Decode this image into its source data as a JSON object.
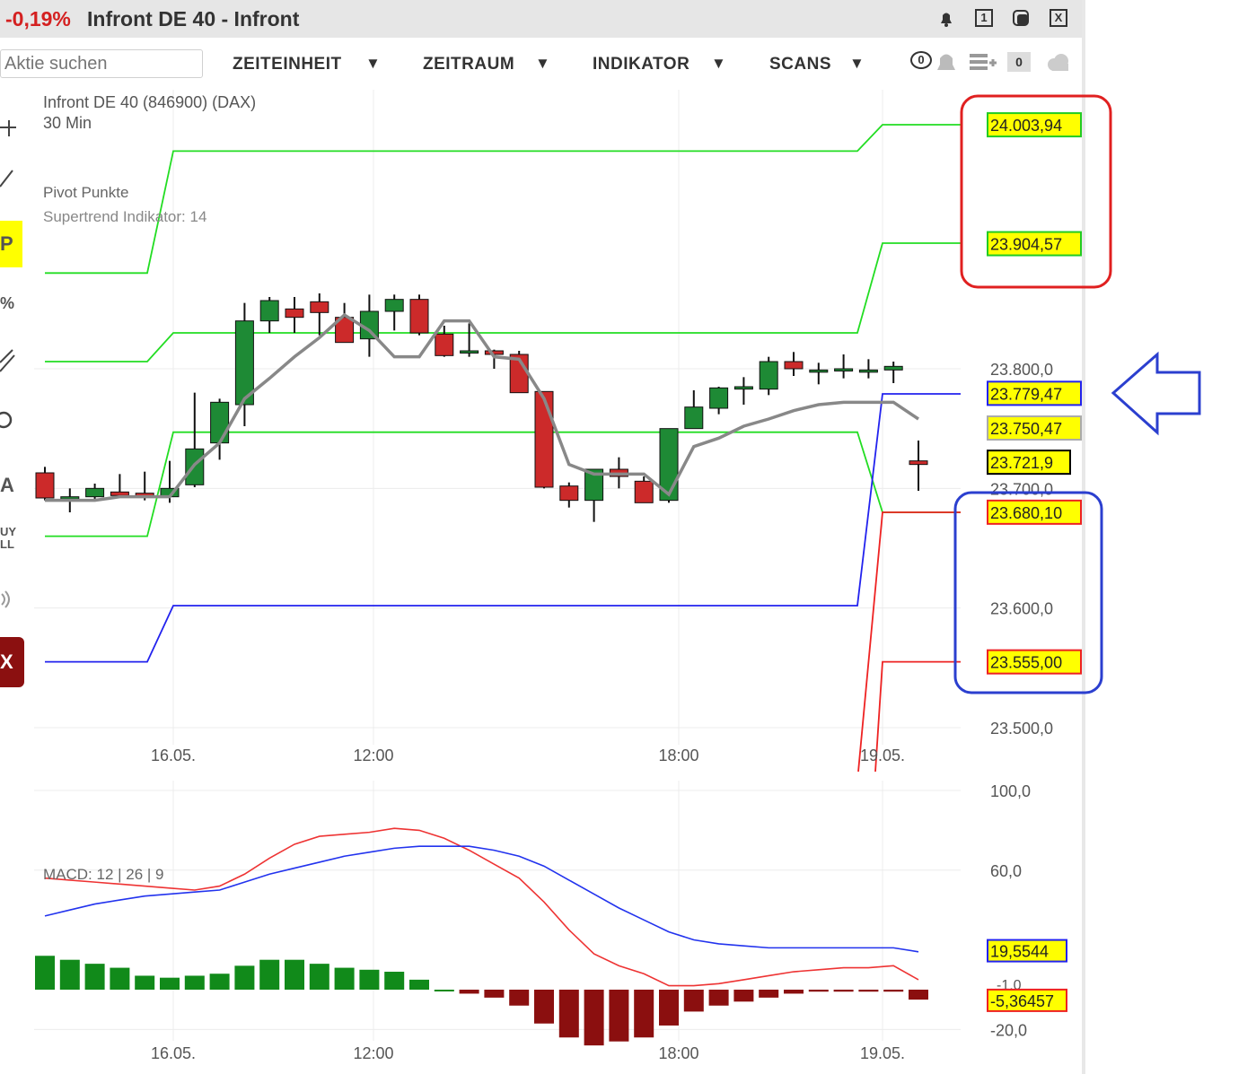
{
  "window": {
    "change": "-0,19%",
    "title": "Infront DE 40 - Infront",
    "buttons": [
      "1",
      "X"
    ],
    "icons": [
      "bell-icon",
      "window-restore-icon",
      "window-max-icon",
      "close-icon"
    ]
  },
  "toolbar": {
    "search_placeholder": "Aktie suchen",
    "menus": [
      "ZEITEINHEIT",
      "ZEITRAUM",
      "INDIKATOR",
      "SCANS"
    ],
    "dropdown_glyph": "▼",
    "alert_count": "0",
    "watch_count": "0"
  },
  "leftbar": {
    "tools": [
      "crosshair-icon",
      "line-icon",
      "pivot-p-icon",
      "percent-icon",
      "parallel-icon",
      "circle-icon",
      "text-icon",
      "buy-sell-icon",
      "sound-icon",
      "delete-icon"
    ],
    "labels": [
      "P",
      "%",
      "A",
      "UY",
      "LL",
      "X"
    ]
  },
  "chart_data": [
    {
      "type": "candlestick",
      "title": "Infront DE 40 (846900) (DAX)",
      "subtitle": "30 Min",
      "indicators": [
        "Pivot Punkte",
        "Supertrend Indikator: 14"
      ],
      "x_ticks": [
        "16.05.",
        "12:00",
        "18:00",
        "19.05."
      ],
      "y_ticks": [
        "23.800,0",
        "23.700,0",
        "23.600,0",
        "23.500,0"
      ],
      "ylim": [
        23488,
        24030
      ],
      "candles": [
        {
          "o": 23713,
          "h": 23718,
          "l": 23690,
          "c": 23692
        },
        {
          "o": 23693,
          "h": 23700,
          "l": 23680,
          "c": 23693
        },
        {
          "o": 23693,
          "h": 23704,
          "l": 23690,
          "c": 23700
        },
        {
          "o": 23697,
          "h": 23712,
          "l": 23692,
          "c": 23694
        },
        {
          "o": 23696,
          "h": 23714,
          "l": 23690,
          "c": 23693
        },
        {
          "o": 23693,
          "h": 23723,
          "l": 23688,
          "c": 23700
        },
        {
          "o": 23703,
          "h": 23780,
          "l": 23701,
          "c": 23733
        },
        {
          "o": 23738,
          "h": 23775,
          "l": 23724,
          "c": 23772
        },
        {
          "o": 23770,
          "h": 23855,
          "l": 23752,
          "c": 23840
        },
        {
          "o": 23840,
          "h": 23860,
          "l": 23830,
          "c": 23857
        },
        {
          "o": 23850,
          "h": 23860,
          "l": 23830,
          "c": 23843
        },
        {
          "o": 23856,
          "h": 23863,
          "l": 23828,
          "c": 23847
        },
        {
          "o": 23843,
          "h": 23855,
          "l": 23822,
          "c": 23822
        },
        {
          "o": 23825,
          "h": 23862,
          "l": 23810,
          "c": 23848
        },
        {
          "o": 23848,
          "h": 23862,
          "l": 23832,
          "c": 23858
        },
        {
          "o": 23858,
          "h": 23862,
          "l": 23828,
          "c": 23830
        },
        {
          "o": 23829,
          "h": 23836,
          "l": 23810,
          "c": 23811
        },
        {
          "o": 23814,
          "h": 23838,
          "l": 23810,
          "c": 23815
        },
        {
          "o": 23815,
          "h": 23816,
          "l": 23800,
          "c": 23812
        },
        {
          "o": 23812,
          "h": 23815,
          "l": 23780,
          "c": 23780
        },
        {
          "o": 23781,
          "h": 23781,
          "l": 23700,
          "c": 23701
        },
        {
          "o": 23702,
          "h": 23705,
          "l": 23684,
          "c": 23690
        },
        {
          "o": 23690,
          "h": 23716,
          "l": 23672,
          "c": 23716
        },
        {
          "o": 23716,
          "h": 23726,
          "l": 23700,
          "c": 23710
        },
        {
          "o": 23706,
          "h": 23710,
          "l": 23688,
          "c": 23688
        },
        {
          "o": 23690,
          "h": 23750,
          "l": 23688,
          "c": 23750
        },
        {
          "o": 23750,
          "h": 23782,
          "l": 23750,
          "c": 23768
        },
        {
          "o": 23767,
          "h": 23785,
          "l": 23762,
          "c": 23784
        },
        {
          "o": 23783,
          "h": 23793,
          "l": 23770,
          "c": 23785
        },
        {
          "o": 23783,
          "h": 23810,
          "l": 23778,
          "c": 23806
        },
        {
          "o": 23806,
          "h": 23814,
          "l": 23794,
          "c": 23800
        },
        {
          "o": 23799,
          "h": 23805,
          "l": 23787,
          "c": 23799
        },
        {
          "o": 23799,
          "h": 23812,
          "l": 23792,
          "c": 23800
        },
        {
          "o": 23799,
          "h": 23808,
          "l": 23792,
          "c": 23799
        },
        {
          "o": 23799,
          "h": 23806,
          "l": 23788,
          "c": 23802
        },
        {
          "o": 23723,
          "h": 23740,
          "l": 23698,
          "c": 23720
        }
      ],
      "supertrend": [
        23690,
        23690,
        23690,
        23693,
        23693,
        23693,
        23720,
        23738,
        23775,
        23792,
        23810,
        23826,
        23845,
        23832,
        23810,
        23810,
        23840,
        23840,
        23810,
        23808,
        23775,
        23720,
        23712,
        23712,
        23712,
        23695,
        23735,
        23742,
        23752,
        23758,
        23765,
        23770,
        23772,
        23772,
        23772,
        23758
      ],
      "pivot_lines": [
        {
          "name": "R2",
          "color": "#22dd22",
          "values": [
            23880,
            23880,
            23880,
            23880,
            23880,
            23982,
            23982,
            23982,
            23982,
            23982,
            23982,
            23982,
            23982,
            23982,
            23982,
            23982,
            23982,
            23982,
            23982,
            23982,
            23982,
            23982,
            23982,
            23982,
            23982,
            23982,
            23982,
            23982,
            23982,
            23982,
            23982,
            23982,
            23982,
            23982,
            23982,
            24004
          ]
        },
        {
          "name": "R1",
          "color": "#22dd22",
          "values": [
            23806,
            23806,
            23806,
            23806,
            23806,
            23830,
            23830,
            23830,
            23830,
            23830,
            23830,
            23830,
            23830,
            23830,
            23830,
            23830,
            23830,
            23830,
            23830,
            23830,
            23830,
            23830,
            23830,
            23830,
            23830,
            23830,
            23830,
            23830,
            23830,
            23830,
            23830,
            23830,
            23830,
            23830,
            23830,
            23905
          ]
        },
        {
          "name": "S1",
          "color": "#22dd22",
          "values": [
            23660,
            23660,
            23660,
            23660,
            23660,
            23747,
            23747,
            23747,
            23747,
            23747,
            23747,
            23747,
            23747,
            23747,
            23747,
            23747,
            23747,
            23747,
            23747,
            23747,
            23747,
            23747,
            23747,
            23747,
            23747,
            23747,
            23747,
            23747,
            23747,
            23747,
            23747,
            23747,
            23747,
            23747,
            23747,
            23680
          ]
        },
        {
          "name": "P",
          "color": "#2222ee",
          "values": [
            23555,
            23555,
            23555,
            23555,
            23555,
            23602,
            23602,
            23602,
            23602,
            23602,
            23602,
            23602,
            23602,
            23602,
            23602,
            23602,
            23602,
            23602,
            23602,
            23602,
            23602,
            23602,
            23602,
            23602,
            23602,
            23602,
            23602,
            23602,
            23602,
            23602,
            23602,
            23602,
            23602,
            23602,
            23602,
            23779
          ]
        },
        {
          "name": "S2",
          "color": "#ee2222",
          "values": [
            23680,
            23555
          ]
        }
      ],
      "price_labels": [
        {
          "value": "24.003,94",
          "bg": "#ffff00",
          "border": "#22cc22"
        },
        {
          "value": "23.904,57",
          "bg": "#ffff00",
          "border": "#22cc22"
        },
        {
          "value": "23.779,47",
          "bg": "#ffff00",
          "border": "#2222ee"
        },
        {
          "value": "23.750,47",
          "bg": "#ffff00",
          "border": "#aaaaaa"
        },
        {
          "value": "23.721,9",
          "bg": "#ffff00",
          "border": "#000000"
        },
        {
          "value": "23.680,10",
          "bg": "#ffff00",
          "border": "#ee2222"
        },
        {
          "value": "23.555,00",
          "bg": "#ffff00",
          "border": "#ee2222"
        }
      ]
    },
    {
      "type": "macd",
      "title": "MACD: 12 | 26 | 9",
      "x_ticks": [
        "16.05.",
        "12:00",
        "18:00",
        "19.05."
      ],
      "y_ticks": [
        "100,0",
        "60,0",
        "-20,0"
      ],
      "ylim": [
        -20,
        100
      ],
      "macd_line": [
        56,
        55,
        54,
        53,
        52,
        51,
        50,
        52,
        58,
        66,
        73,
        77,
        78,
        79,
        81,
        80,
        76,
        70,
        63,
        56,
        44,
        30,
        18,
        12,
        8,
        2,
        2,
        3,
        5,
        7,
        9,
        10,
        11,
        11,
        12,
        5
      ],
      "signal_line": [
        37,
        40,
        43,
        45,
        47,
        48,
        49,
        50,
        54,
        58,
        61,
        64,
        67,
        69,
        71,
        72,
        72,
        72,
        70,
        67,
        62,
        55,
        48,
        41,
        35,
        29,
        25,
        23,
        22,
        21,
        21,
        21,
        21,
        21,
        21,
        19
      ],
      "histogram": [
        17,
        15,
        13,
        11,
        7,
        6,
        7,
        8,
        12,
        15,
        15,
        13,
        11,
        10,
        9,
        5,
        0,
        -2,
        -4,
        -8,
        -17,
        -24,
        -28,
        -26,
        -24,
        -18,
        -11,
        -8,
        -6,
        -4,
        -2,
        -1,
        -1,
        -1,
        -1,
        -5
      ],
      "value_labels": [
        {
          "value": "19,5544",
          "bg": "#ffff00",
          "border": "#2222ee"
        },
        {
          "value": "-5,36457",
          "bg": "#ffff00",
          "border": "#ee2222"
        }
      ],
      "hidden_label": "-1,0"
    }
  ],
  "highlight": {
    "red_box": "#e02020",
    "blue_box": "#2b3fcf",
    "arrow": "#2b3fcf"
  }
}
